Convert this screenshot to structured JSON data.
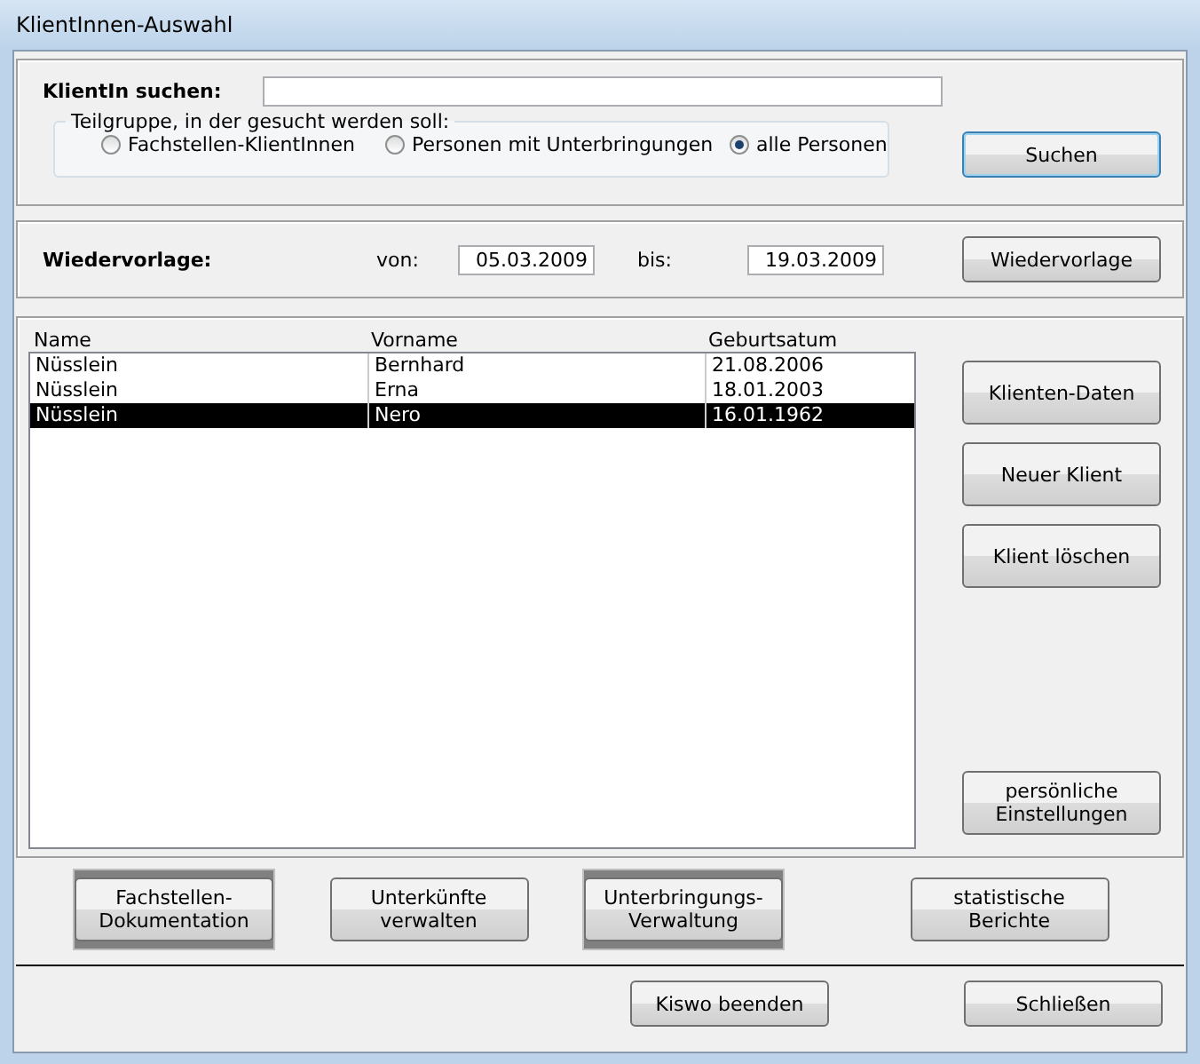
{
  "window": {
    "title": "KlientInnen-Auswahl"
  },
  "search": {
    "label": "KlientIn suchen:",
    "group_label": "Teilgruppe, in der gesucht werden soll:",
    "options": [
      {
        "label": "Fachstellen-KlientInnen",
        "selected": false
      },
      {
        "label": "Personen mit Unterbringungen",
        "selected": false
      },
      {
        "label": "alle Personen",
        "selected": true
      }
    ],
    "button": "Suchen"
  },
  "resubmission": {
    "label": "Wiedervorlage:",
    "from_label": "von:",
    "from": "05.03.2009",
    "to_label": "bis:",
    "to": "19.03.2009",
    "button": "Wiedervorlage"
  },
  "table": {
    "columns": [
      "Name",
      "Vorname",
      "Geburtsatum"
    ],
    "rows": [
      {
        "cells": [
          "Nüsslein",
          "Bernhard",
          "21.08.2006"
        ],
        "selected": false
      },
      {
        "cells": [
          "Nüsslein",
          "Erna",
          "18.01.2003"
        ],
        "selected": false
      },
      {
        "cells": [
          "Nüsslein",
          "Nero",
          "16.01.1962"
        ],
        "selected": true
      }
    ]
  },
  "side_buttons": [
    "Klienten-Daten",
    "Neuer Klient",
    "Klient löschen"
  ],
  "settings_button": "persönliche Einstellungen",
  "module_buttons": [
    {
      "label": "Fachstellen-\nDokumentation",
      "highlighted": true
    },
    {
      "label": "Unterkünfte\nverwalten",
      "highlighted": false
    },
    {
      "label": "Unterbringungs-\nVerwaltung",
      "highlighted": true
    },
    {
      "label": "statistische\nBerichte",
      "highlighted": false
    }
  ],
  "footer_buttons": [
    "Kiswo beenden",
    "Schließen"
  ]
}
